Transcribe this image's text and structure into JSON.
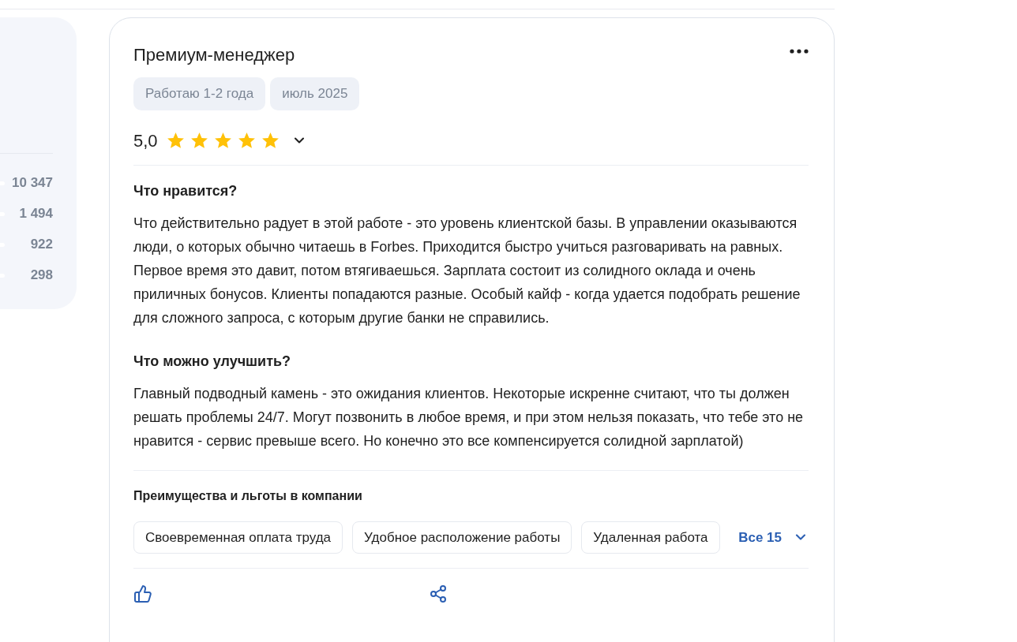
{
  "stats": [
    {
      "count": "10 347"
    },
    {
      "count": "1 494"
    },
    {
      "count": "922"
    },
    {
      "count": "298"
    }
  ],
  "review": {
    "title": "Премиум-менеджер",
    "tags": [
      "Работаю 1-2 года",
      "июль 2025"
    ],
    "rating": "5,0",
    "stars": 5,
    "sections": [
      {
        "heading": "Что нравится?",
        "text": "Что действительно радует в этой работе - это уровень клиентской базы. В управлении оказываются люди, о которых обычно читаешь в Forbes. Приходится быстро учиться разговаривать на равных. Первое время это давит, потом втягиваешься. Зарплата состоит из солидного оклада и очень приличных бонусов. Клиенты попадаются разные. Особый кайф - когда удается подобрать решение для сложного запроса, с которым другие банки не справились."
      },
      {
        "heading": "Что можно улучшить?",
        "text": "Главный подводный камень - это ожидания клиентов. Некоторые искренне считают, что ты должен решать проблемы 24/7. Могут позвонить в любое время, и при этом нельзя показать, что тебе это не нравится - сервис превыше всего. Но конечно это все компенсируется солидной зарплатой)"
      }
    ],
    "benefits": {
      "heading": "Преимущества и льготы в компании",
      "items": [
        "Своевременная оплата труда",
        "Удобное расположение работы",
        "Удаленная работа"
      ],
      "more": "Все 15"
    }
  }
}
